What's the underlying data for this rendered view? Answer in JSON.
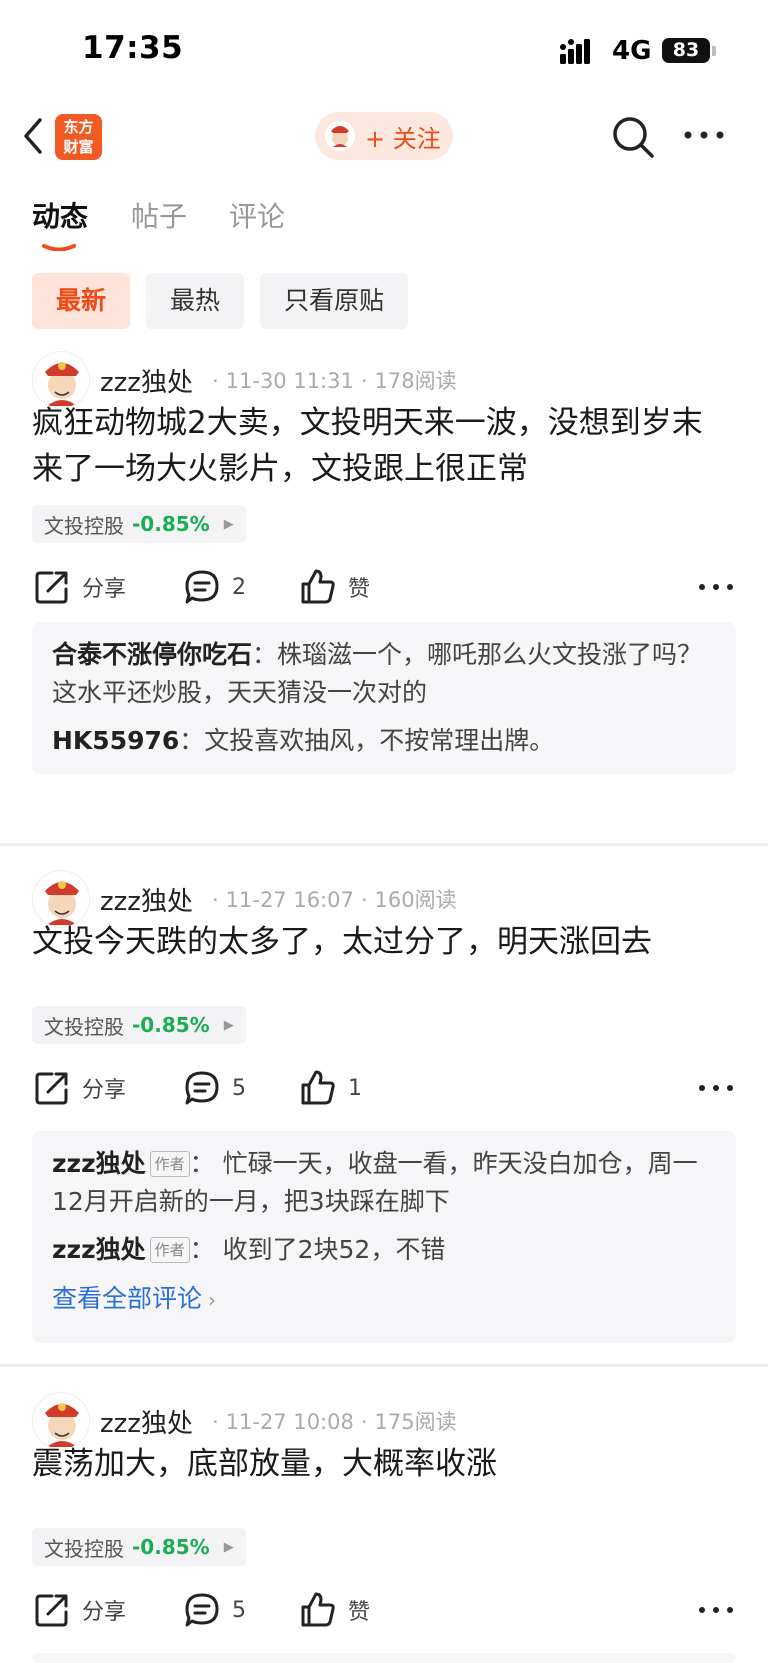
{
  "status": {
    "time": "17:35",
    "network": "4G",
    "battery": "83"
  },
  "nav": {
    "logo_line1": "东方",
    "logo_line2": "财富",
    "follow_label": "+ 关注"
  },
  "tabs": [
    {
      "label": "动态"
    },
    {
      "label": "帖子"
    },
    {
      "label": "评论"
    }
  ],
  "filters": [
    {
      "label": "最新"
    },
    {
      "label": "最热"
    },
    {
      "label": "只看原贴"
    }
  ],
  "posts": [
    {
      "author": "zzz独处",
      "datetime": "11-30 11:31",
      "reads": "178阅读",
      "text": "疯狂动物城2大卖，文投明天来一波，没想到岁末来了一场大火影片，文投跟上很正常",
      "stock": {
        "name": "文投控股",
        "change": "-0.85%"
      },
      "actions": {
        "share": "分享",
        "comments": "2",
        "likes": "赞"
      },
      "comments": [
        {
          "author": "合泰不涨停你吃石",
          "text": "：株瑙滋一个，哪吒那么火文投涨了吗？这水平还炒股，天天猜没一次对的"
        },
        {
          "author": "HK55976",
          "text": "：文投喜欢抽风，不按常理出牌。"
        }
      ]
    },
    {
      "author": "zzz独处",
      "datetime": "11-27 16:07",
      "reads": "160阅读",
      "text": "文投今天跌的太多了，太过分了，明天涨回去",
      "stock": {
        "name": "文投控股",
        "change": "-0.85%"
      },
      "actions": {
        "share": "分享",
        "comments": "5",
        "likes": "1"
      },
      "comments": [
        {
          "author": "zzz独处",
          "tag": "作者",
          "text": "： 忙碌一天，收盘一看，昨天没白加仓，周一12月开启新的一月，把3块踩在脚下"
        },
        {
          "author": "zzz独处",
          "tag": "作者",
          "text": "： 收到了2块52，不错"
        }
      ],
      "view_all": "查看全部评论"
    },
    {
      "author": "zzz独处",
      "datetime": "11-27 10:08",
      "reads": "175阅读",
      "text": "震荡加大，底部放量，大概率收涨",
      "stock": {
        "name": "文投控股",
        "change": "-0.85%"
      },
      "actions": {
        "share": "分享",
        "comments": "5",
        "likes": "赞"
      }
    }
  ]
}
